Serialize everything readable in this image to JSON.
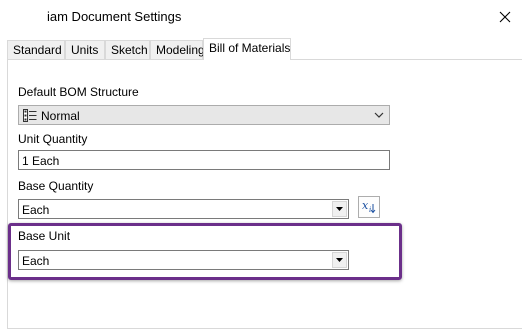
{
  "window": {
    "title": "iam Document Settings",
    "close_icon": "close-icon"
  },
  "tabs": [
    {
      "label": "Standard",
      "active": false
    },
    {
      "label": "Units",
      "active": false
    },
    {
      "label": "Sketch",
      "active": false
    },
    {
      "label": "Modeling",
      "active": false
    },
    {
      "label": "Bill of Materials",
      "active": true
    }
  ],
  "bom": {
    "default_structure_label": "Default BOM Structure",
    "default_structure_value": "Normal",
    "default_structure_icon": "bom-structure-icon",
    "unit_quantity_label": "Unit Quantity",
    "unit_quantity_value": "1 Each",
    "base_quantity_label": "Base Quantity",
    "base_quantity_value": "Each",
    "fx_icon": "function-parameter-icon",
    "base_unit_label": "Base Unit",
    "base_unit_value": "Each"
  },
  "colors": {
    "highlight": "#6b2f8a"
  }
}
